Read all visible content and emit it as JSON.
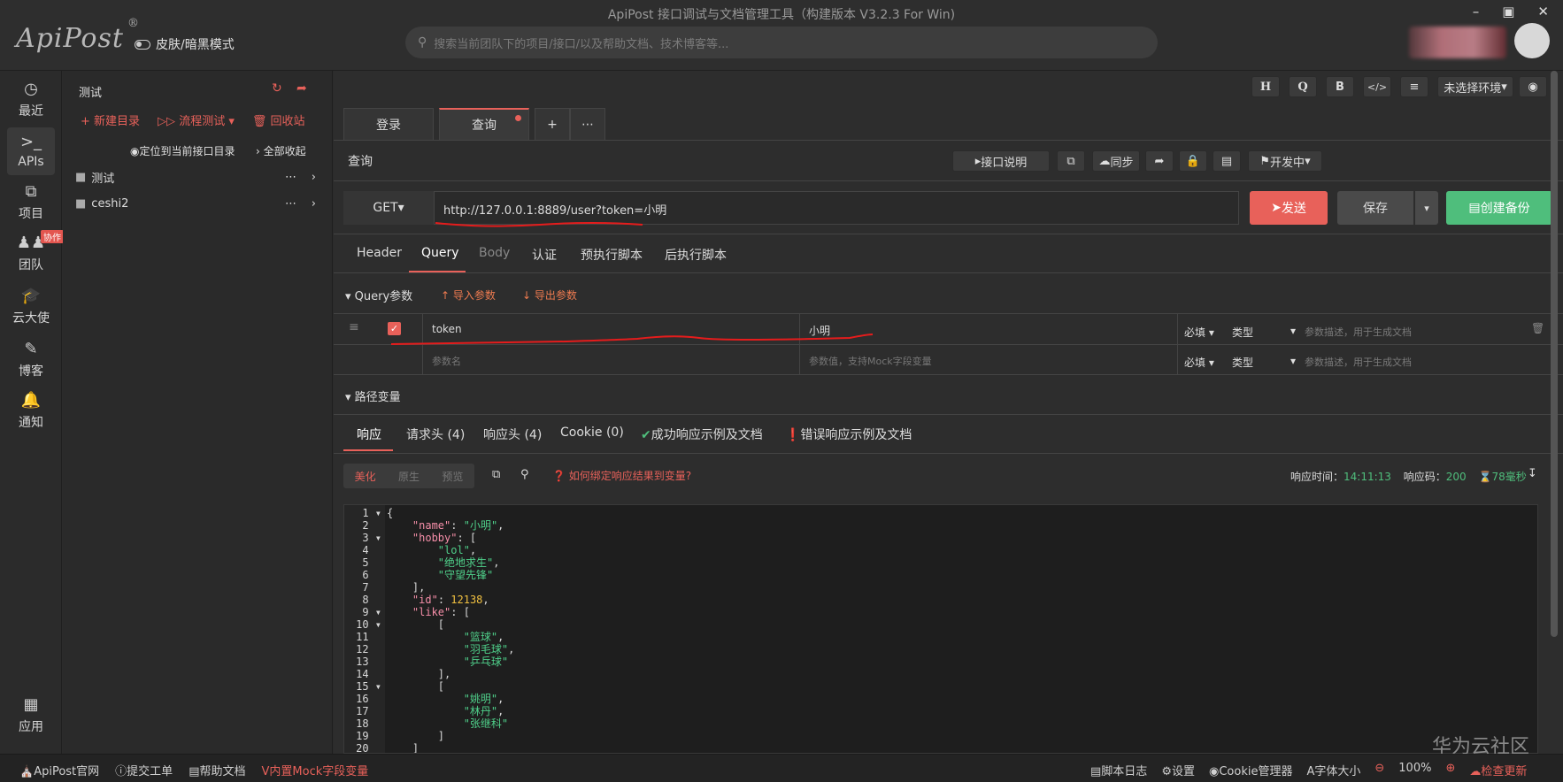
{
  "window": {
    "title": "ApiPost 接口调试与文档管理工具（构建版本 V3.2.3 For Win)"
  },
  "brand": {
    "logo": "ApiPost",
    "reg": "®"
  },
  "theme_toggle": {
    "label": "皮肤/暗黑模式"
  },
  "search": {
    "placeholder": "搜索当前团队下的项目/接口/以及帮助文档、技术博客等..."
  },
  "nav": {
    "items": [
      {
        "label": "最近",
        "icon": "clock-icon"
      },
      {
        "label": "APIs",
        "icon": "terminal-icon"
      },
      {
        "label": "项目",
        "icon": "project-icon"
      },
      {
        "label": "团队",
        "icon": "team-icon",
        "badge": "协作"
      },
      {
        "label": "云大使",
        "icon": "graduation-cap-icon"
      },
      {
        "label": "博客",
        "icon": "edit-icon"
      },
      {
        "label": "通知",
        "icon": "bell-icon"
      },
      {
        "label": "应用",
        "icon": "apps-grid-icon"
      }
    ]
  },
  "tree": {
    "project": "测试",
    "new_dir": "新建目录",
    "flow_test": "流程测试",
    "recycle": "回收站",
    "locate": "定位到当前接口目录",
    "collapse_all": "全部收起",
    "folders": [
      "测试",
      "ceshi2"
    ]
  },
  "toolbar": {
    "h": "H",
    "q": "Q",
    "b": "B",
    "code": "</>",
    "env": "未选择环境"
  },
  "tabs": [
    {
      "label": "登录"
    },
    {
      "label": "查询"
    }
  ],
  "request": {
    "name": "查询",
    "doc_btn": "接口说明",
    "sync_btn": "同步",
    "status_btn": "开发中",
    "method": "GET",
    "url": "http://127.0.0.1:8889/user?token=小明",
    "send": "发送",
    "save": "保存",
    "backup": "创建备份"
  },
  "req_tabs": [
    "Header",
    "Query",
    "Body",
    "认证",
    "预执行脚本",
    "后执行脚本"
  ],
  "query": {
    "section": "Query参数",
    "import": "导入参数",
    "export": "导出参数",
    "rows": [
      {
        "key": "token",
        "value": "小明",
        "required": "必填",
        "type": "类型",
        "desc_placeholder": "参数描述，用于生成文档"
      }
    ],
    "new_row": {
      "key_placeholder": "参数名",
      "value_placeholder": "参数值，支持Mock字段变量",
      "required": "必填",
      "type": "类型",
      "desc_placeholder": "参数描述，用于生成文档"
    }
  },
  "path_vars": {
    "section": "路径变量"
  },
  "resp_tabs": [
    "响应",
    "请求头 (4)",
    "响应头 (4)",
    "Cookie (0)",
    "成功响应示例及文档",
    "错误响应示例及文档"
  ],
  "resp_toolbar": {
    "beautify": "美化",
    "raw": "原生",
    "preview": "预览",
    "bind_hint": "如何绑定响应结果到变量?",
    "time_label": "响应时间：",
    "time": "14:11:13",
    "code_label": "响应码：",
    "code": "200",
    "duration": "78毫秒"
  },
  "code_lines": [
    "{",
    "    \"name\": \"小明\",",
    "    \"hobby\": [",
    "        \"lol\",",
    "        \"绝地求生\",",
    "        \"守望先锋\"",
    "    ],",
    "    \"id\": 12138,",
    "    \"like\": [",
    "        [",
    "            \"篮球\",",
    "            \"羽毛球\",",
    "            \"乒乓球\"",
    "        ],",
    "        [",
    "            \"姚明\",",
    "            \"林丹\",",
    "            \"张继科\"",
    "        ]",
    "    ]"
  ],
  "status": {
    "site": "ApiPost官网",
    "ticket": "提交工单",
    "help": "帮助文档",
    "mock": "内置Mock字段变量",
    "log": "脚本日志",
    "settings": "设置",
    "cookie": "Cookie管理器",
    "font": "字体大小",
    "zoom": "100%",
    "update": "检查更新"
  },
  "watermark": "华为云社区"
}
